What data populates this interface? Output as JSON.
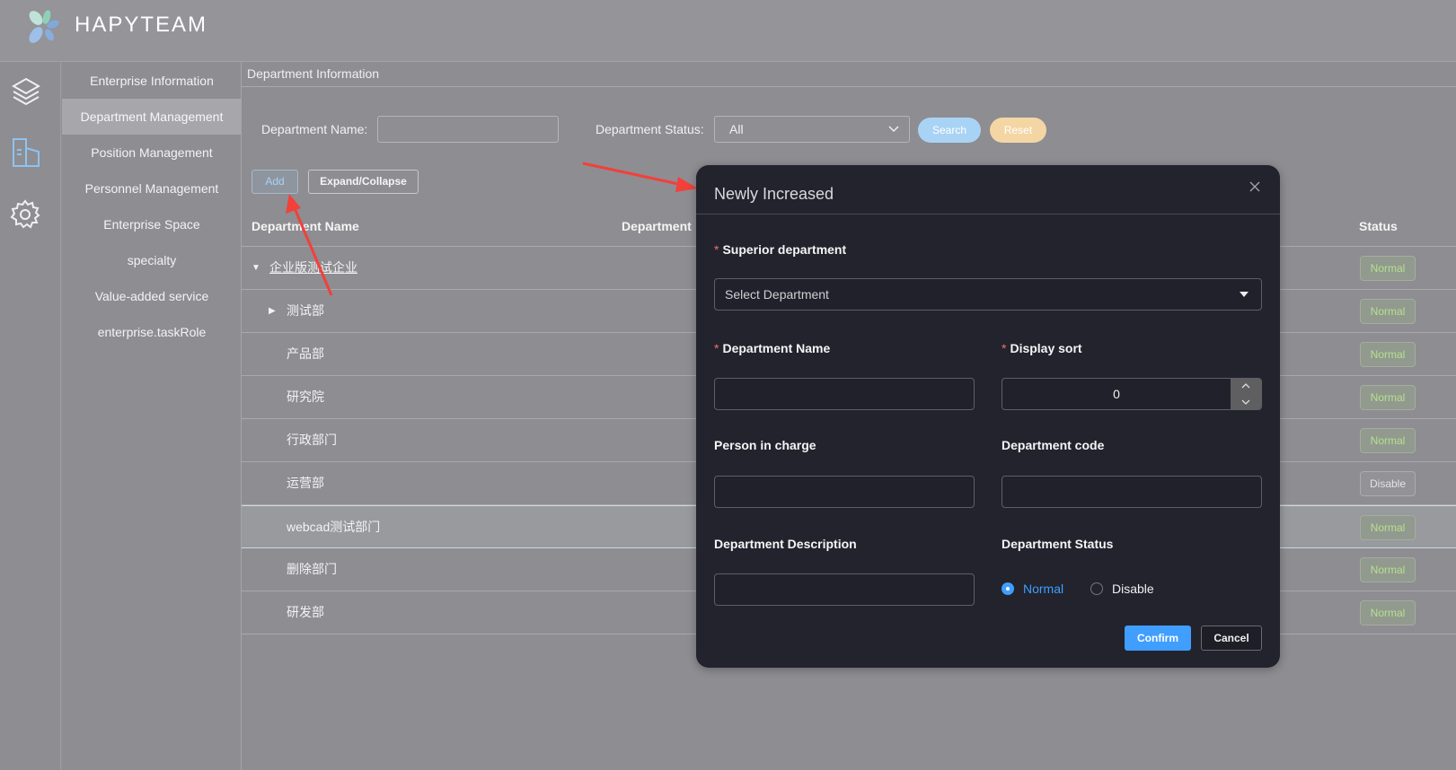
{
  "app": {
    "brand": "HAPYTEAM"
  },
  "rail": {
    "icons": [
      "layers-icon",
      "building-icon",
      "gear-icon"
    ]
  },
  "submenu": {
    "items": [
      {
        "label": "Enterprise Information"
      },
      {
        "label": "Department Management",
        "active": true
      },
      {
        "label": "Position Management"
      },
      {
        "label": "Personnel Management"
      },
      {
        "label": "Enterprise Space"
      },
      {
        "label": "specialty"
      },
      {
        "label": "Value-added service"
      },
      {
        "label": "enterprise.taskRole"
      }
    ]
  },
  "main": {
    "title": "Department Information",
    "filters": {
      "name_label": "Department Name:",
      "name_value": "",
      "status_label": "Department Status:",
      "status_value": "All",
      "search": "Search",
      "reset": "Reset"
    },
    "actions": {
      "add": "Add",
      "expand": "Expand/Collapse"
    },
    "table": {
      "columns": [
        "Department Name",
        "Department",
        "Status"
      ],
      "rows": [
        {
          "name": "企业版测试企业",
          "level": 0,
          "toggle": "expanded",
          "status": "Normal"
        },
        {
          "name": "测试部",
          "level": 1,
          "toggle": "collapsed",
          "status": "Normal"
        },
        {
          "name": "产品部",
          "level": 1,
          "status": "Normal"
        },
        {
          "name": "研究院",
          "level": 1,
          "status": "Normal"
        },
        {
          "name": "行政部门",
          "level": 1,
          "status": "Normal"
        },
        {
          "name": "运营部",
          "level": 1,
          "status": "Disable"
        },
        {
          "name": "webcad测试部门",
          "level": 1,
          "status": "Normal",
          "selected": true
        },
        {
          "name": "删除部门",
          "level": 1,
          "status": "Normal"
        },
        {
          "name": "研发部",
          "level": 1,
          "status": "Normal"
        }
      ]
    }
  },
  "modal": {
    "title": "Newly Increased",
    "superior_label": "Superior department",
    "superior_placeholder": "Select Department",
    "name_label": "Department Name",
    "sort_label": "Display sort",
    "sort_value": "0",
    "person_label": "Person in charge",
    "code_label": "Department code",
    "desc_label": "Department Description",
    "status_label": "Department Status",
    "status_options": [
      "Normal",
      "Disable"
    ],
    "status_selected": "Normal",
    "required_mark": "*",
    "confirm": "Confirm",
    "cancel": "Cancel"
  },
  "colors": {
    "accent": "#409eff",
    "search": "#a9d3f5",
    "reset": "#f4d6a4",
    "normal_text": "#b4e08e",
    "annotation_arrow": "#f2403a"
  }
}
